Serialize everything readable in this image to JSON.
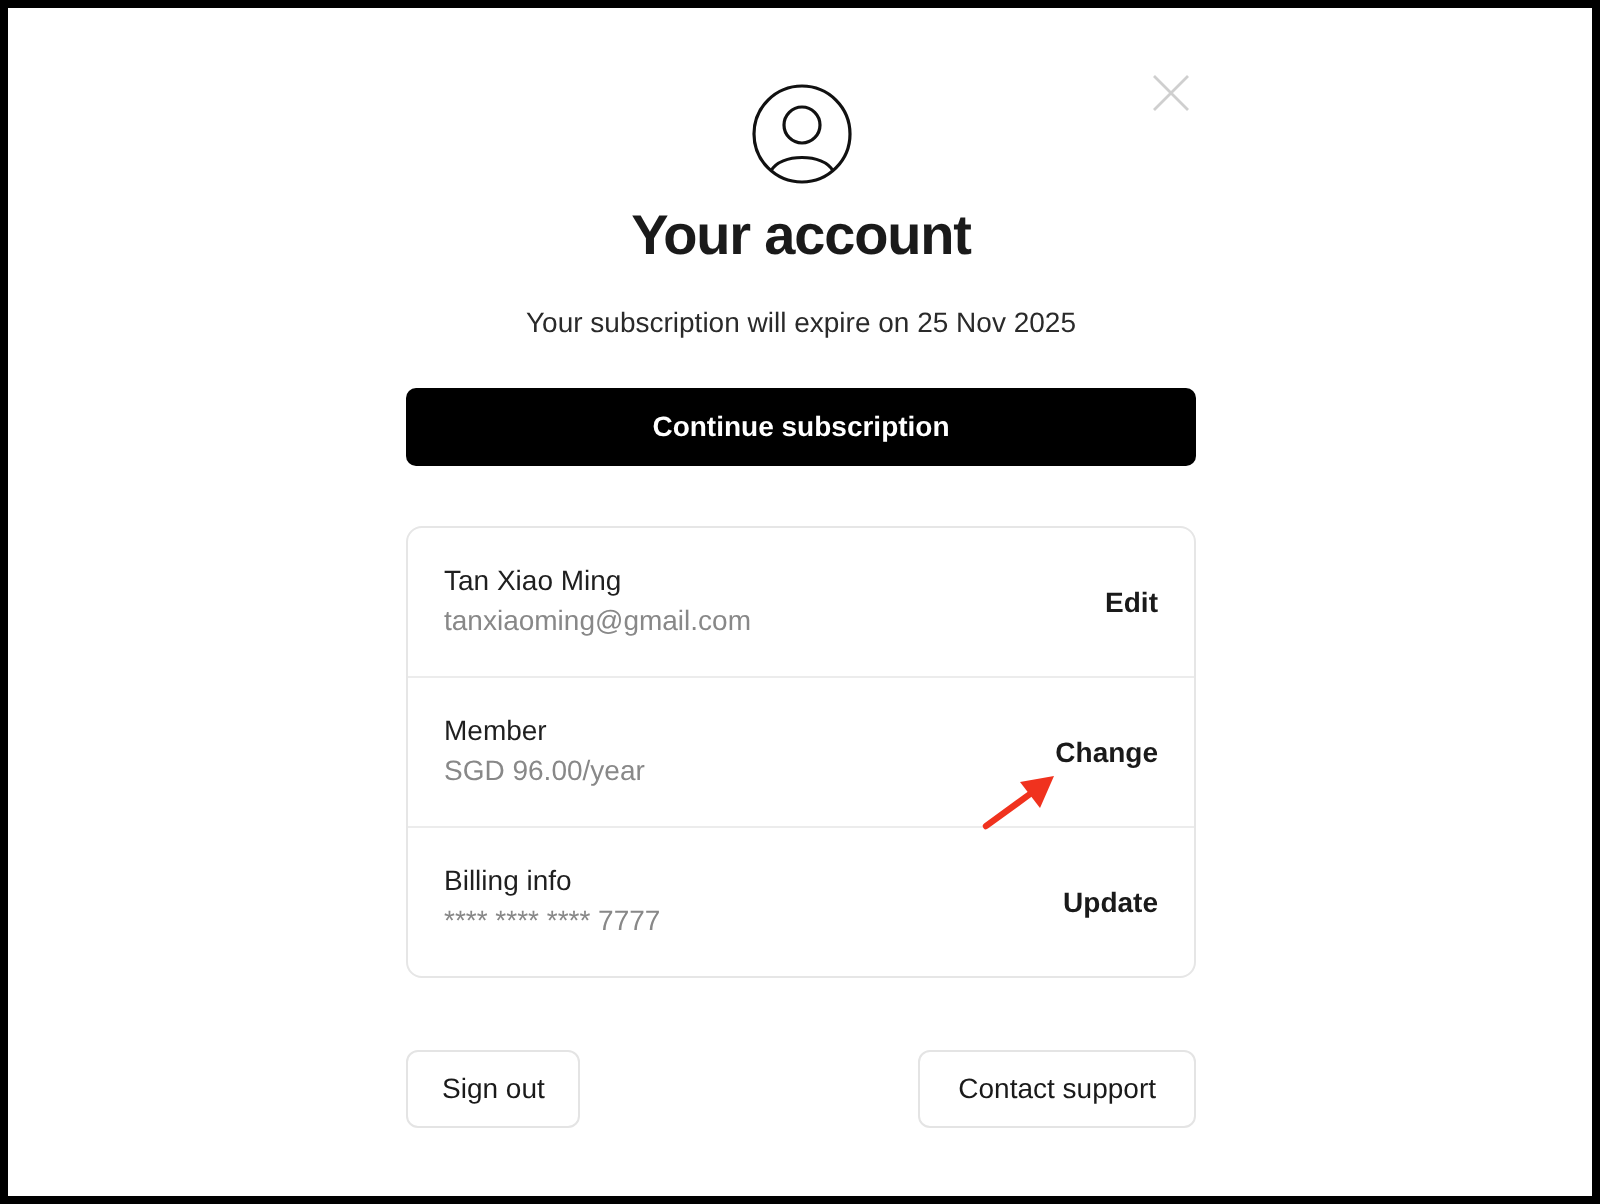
{
  "title": "Your account",
  "subtitle": "Your subscription will expire on 25 Nov 2025",
  "primary_button": {
    "label": "Continue subscription"
  },
  "account_items": [
    {
      "title": "Tan Xiao Ming",
      "detail": "tanxiaoming@gmail.com",
      "action": "Edit",
      "annotated": false
    },
    {
      "title": "Member",
      "detail": "SGD 96.00/year",
      "action": "Change",
      "annotated": true
    },
    {
      "title": "Billing info",
      "detail": "**** **** **** 7777",
      "action": "Update",
      "annotated": false
    }
  ],
  "footer_buttons": [
    {
      "label": "Sign out"
    },
    {
      "label": "Contact support"
    }
  ]
}
